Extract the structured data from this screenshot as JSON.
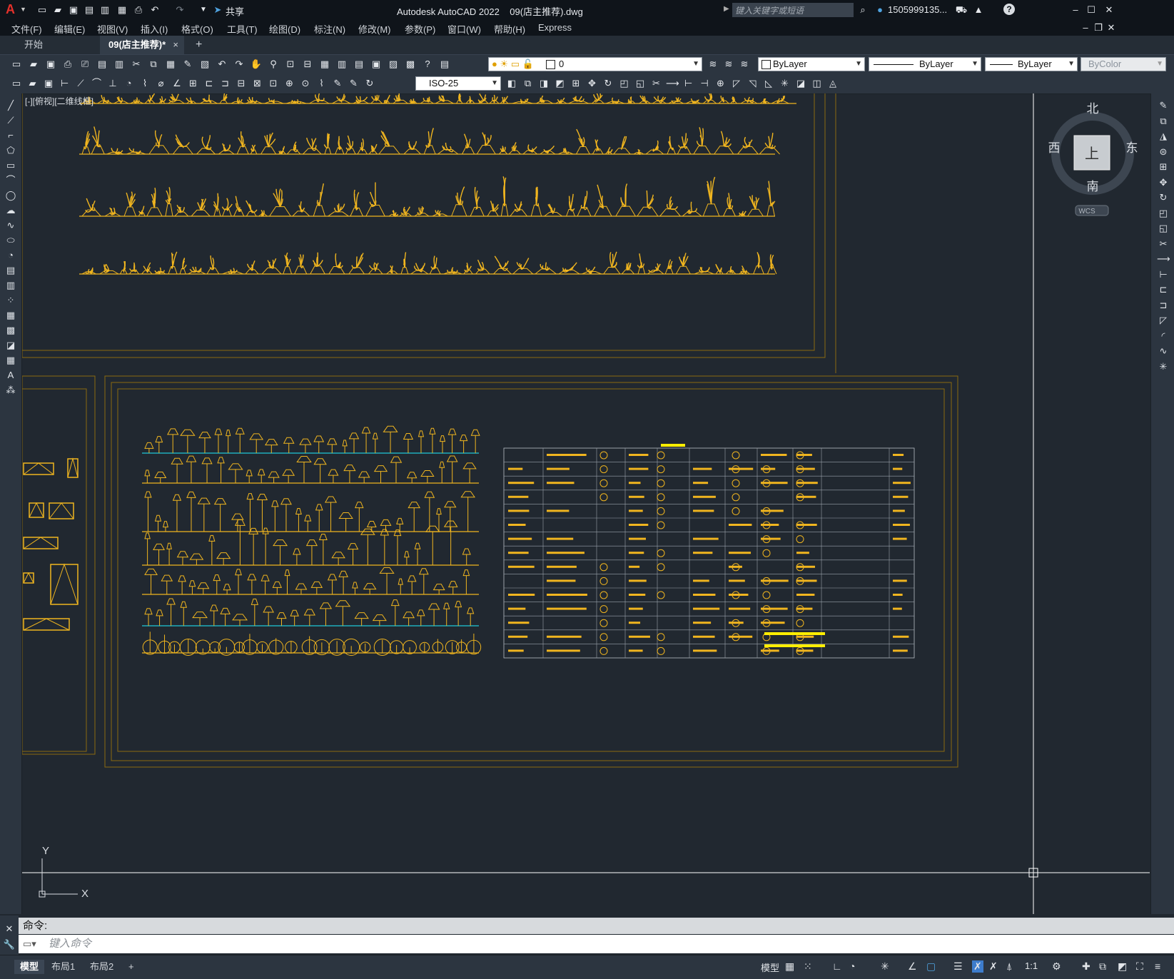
{
  "app": {
    "title": "Autodesk AutoCAD 2022",
    "file": "09(店主推荐).dwg",
    "share_label": "共享",
    "search_placeholder": "键入关键字或短语",
    "user": "1505999135...",
    "help": "?"
  },
  "menu": [
    "文件(F)",
    "编辑(E)",
    "视图(V)",
    "插入(I)",
    "格式(O)",
    "工具(T)",
    "绘图(D)",
    "标注(N)",
    "修改(M)",
    "参数(P)",
    "窗口(W)",
    "帮助(H)",
    "Express"
  ],
  "tabs": {
    "start": "开始",
    "active": "09(店主推荐)*",
    "close": "×",
    "add": "+"
  },
  "properties": {
    "layer": "0",
    "color": "ByLayer",
    "linetype": "ByLayer",
    "lineweight": "ByLayer",
    "plotstyle": "ByColor",
    "dimstyle": "ISO-25"
  },
  "viewport": {
    "label": "[-][俯视][二维线框]",
    "viewcube": {
      "north": "北",
      "south": "南",
      "east": "东",
      "west": "西",
      "top": "上",
      "wcs": "WCS"
    },
    "ucs": {
      "x": "X",
      "y": "Y"
    }
  },
  "command": {
    "history": "命令:",
    "placeholder": "键入命令"
  },
  "layout_tabs": [
    "模型",
    "布局1",
    "布局2",
    "+"
  ],
  "status": {
    "model": "模型",
    "scale": "1:1"
  },
  "colors": {
    "drawing": "#f0b51f",
    "frame": "#8a6a10",
    "background": "#212830",
    "cyan": "#1fc8d8",
    "yellow": "#ffee00"
  }
}
